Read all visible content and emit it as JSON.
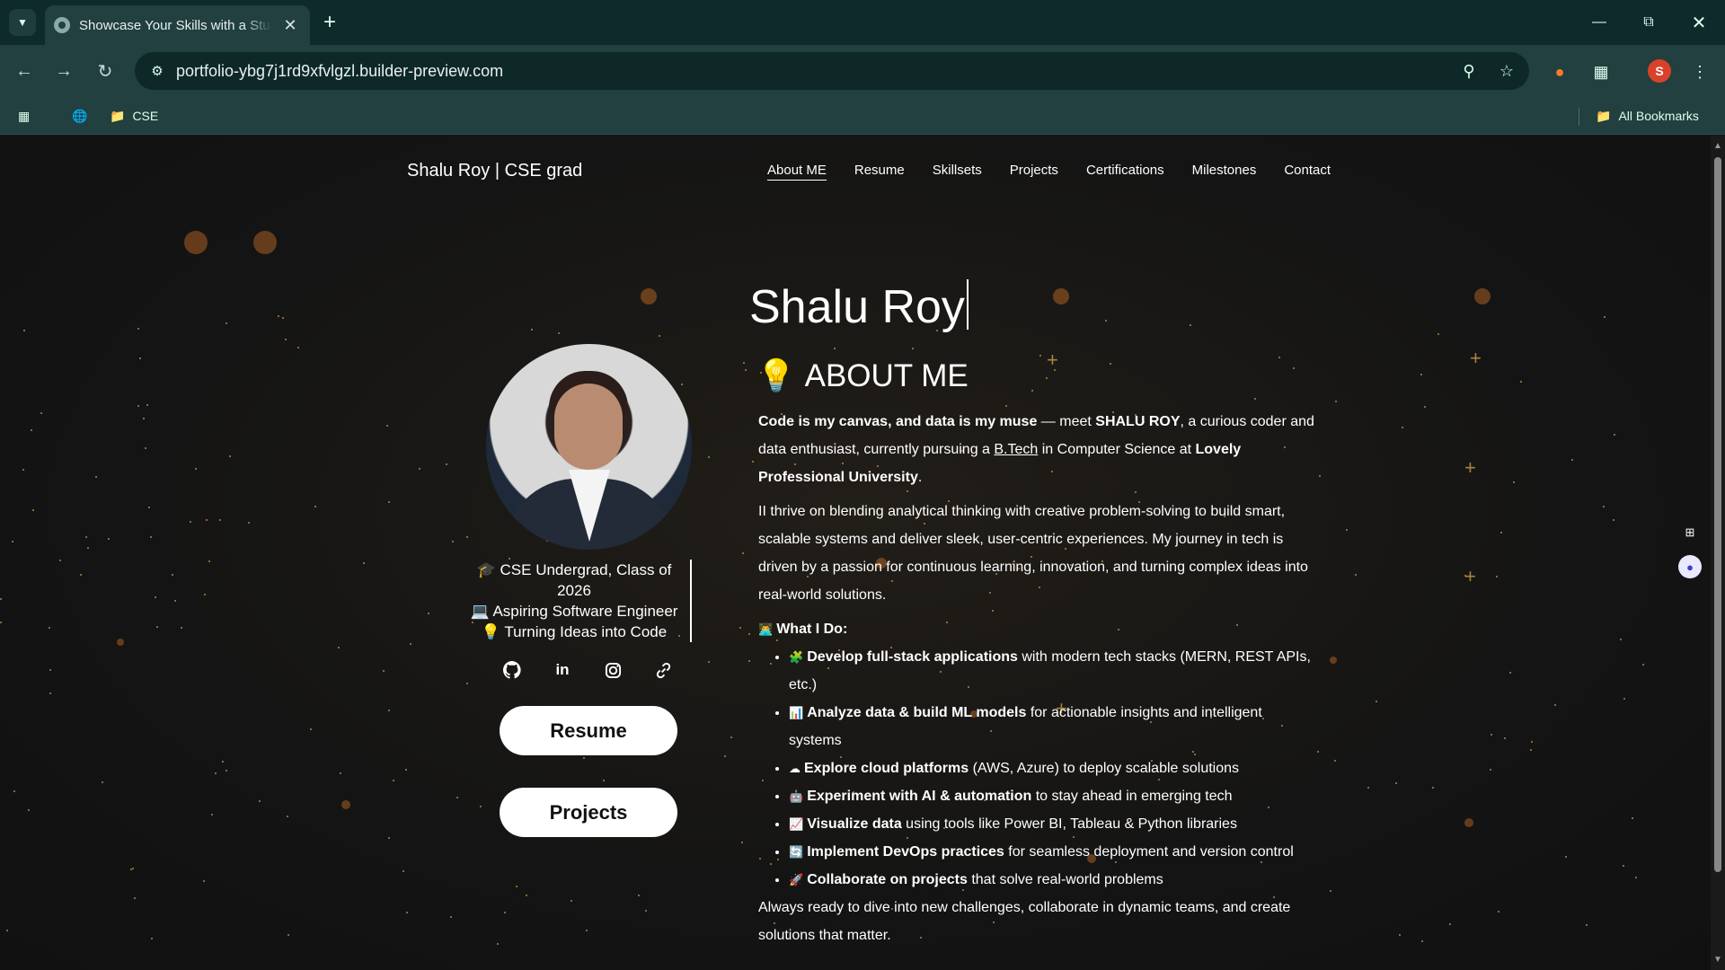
{
  "browser": {
    "tab_title": "Showcase Your Skills with a Stunning Portfolio",
    "url": "portfolio-ybg7j1rd9xfvlgzl.builder-preview.com",
    "bookmark_folder": "CSE",
    "all_bookmarks": "All Bookmarks",
    "profile_initial": "S"
  },
  "site": {
    "brand": "Shalu Roy | CSE grad",
    "nav": [
      "About ME",
      "Resume",
      "Skillsets",
      "Projects",
      "Certifications",
      "Milestones",
      "Contact"
    ],
    "tagline": [
      "🎓 CSE Undergrad, Class of 2026",
      "💻 Aspiring Software Engineer",
      "💡 Turning Ideas into Code"
    ],
    "buttons": {
      "resume": "Resume",
      "projects": "Projects"
    },
    "hero_name": "Shalu Roy",
    "about_heading": "ABOUT ME",
    "about_icon": "💡",
    "intro": {
      "b1": "Code is my canvas, and data is my muse",
      "t1": " — meet ",
      "b2": "SHALU ROY",
      "t2": ", a curious coder and data enthusiast, currently pursuing a ",
      "link": "B.Tech",
      "t3": " in Computer Science at ",
      "b3": "Lovely Professional University",
      "t4": "."
    },
    "para2": "II thrive on blending analytical thinking with creative problem-solving to build smart, scalable systems and deliver sleek, user-centric experiences. My journey in tech is driven by a passion for continuous learning, innovation, and turning complex ideas into real-world solutions.",
    "what_i_do_icon": "👨‍💻",
    "what_i_do": "What I Do:",
    "items": [
      {
        "icon": "🧩",
        "bold": "Develop full-stack applications",
        "rest": " with modern tech stacks (MERN, REST APIs, etc.)"
      },
      {
        "icon": "📊",
        "bold": "Analyze data & build ML models",
        "rest": " for actionable insights and intelligent systems"
      },
      {
        "icon": "☁",
        "bold": "Explore cloud platforms",
        "rest": " (AWS, Azure) to deploy scalable solutions"
      },
      {
        "icon": "🤖",
        "bold": "Experiment with AI & automation",
        "rest": " to stay ahead in emerging tech"
      },
      {
        "icon": "📈",
        "bold": "Visualize data",
        "rest": " using tools like Power BI, Tableau & Python libraries"
      },
      {
        "icon": "🔄",
        "bold": "Implement DevOps practices",
        "rest": " for seamless deployment and version control"
      },
      {
        "icon": "🚀",
        "bold": "Collaborate on projects",
        "rest": " that solve real-world problems"
      }
    ],
    "closing": "Always ready to dive into new challenges, collaborate in dynamic teams, and create solutions that matter."
  }
}
